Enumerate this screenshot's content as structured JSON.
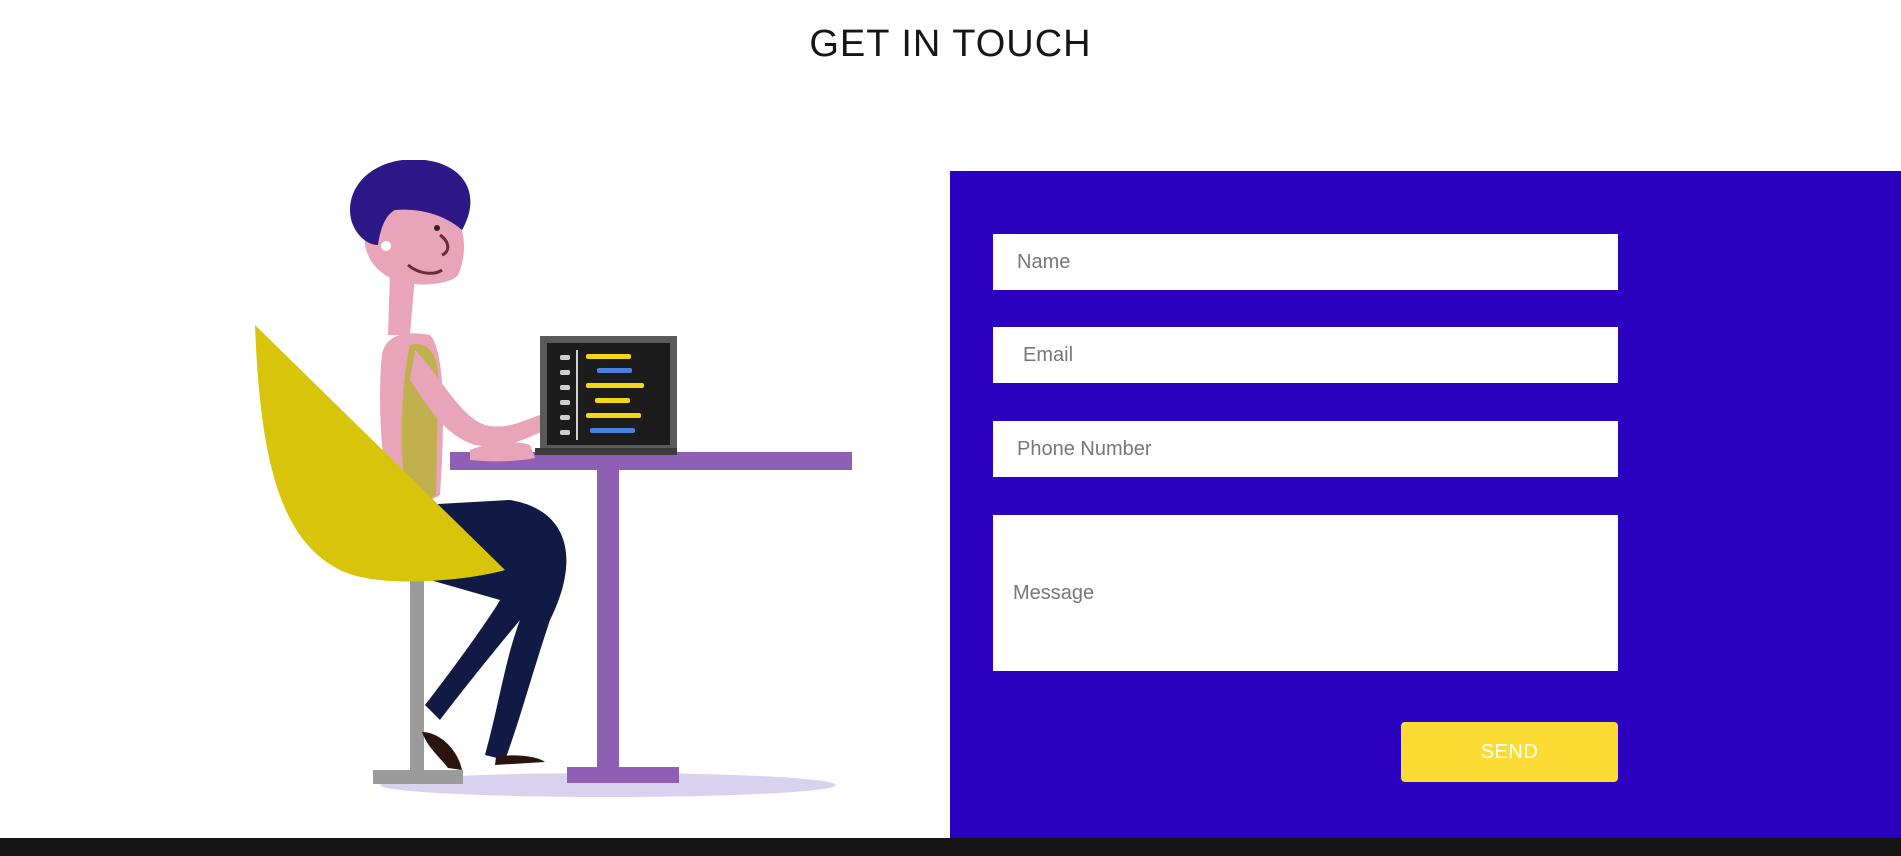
{
  "section": {
    "title": "GET IN TOUCH"
  },
  "form": {
    "name_placeholder": "Name",
    "email_placeholder": "Email",
    "phone_placeholder": "Phone Number",
    "message_placeholder": "Message",
    "send_label": "SEND"
  },
  "colors": {
    "panel": "#2a02bf",
    "button": "#fcdc33",
    "footer": "#141414"
  },
  "illustration": {
    "icon": "person-at-desk-with-laptop"
  }
}
